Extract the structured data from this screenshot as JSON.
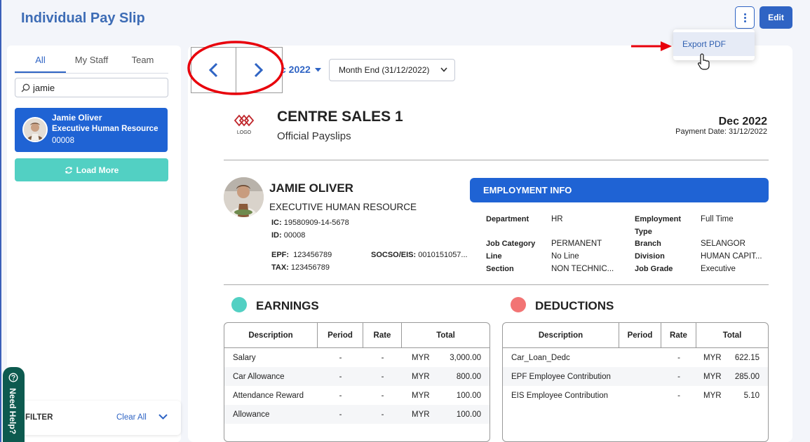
{
  "header": {
    "title": "Individual Pay Slip",
    "edit_label": "Edit",
    "export_pdf": "Export PDF"
  },
  "sidebar": {
    "tabs": [
      {
        "label": "All",
        "active": true
      },
      {
        "label": "My Staff"
      },
      {
        "label": "Team"
      }
    ],
    "search_value": "jamie",
    "staff_card": {
      "name": "Jamie Oliver",
      "role": "Executive Human Resource",
      "id": "00008"
    },
    "load_more": "Load More",
    "filter_label": "FILTER",
    "clear_all": "Clear All",
    "need_help": "Need Help?"
  },
  "toolbar": {
    "year": "c 2022",
    "month": "Month End (31/12/2022)"
  },
  "slip": {
    "logo_text": "LOGO",
    "company": "CENTRE SALES 1",
    "subtitle": "Official Payslips",
    "period": "Dec 2022",
    "payment_date": "Payment Date: 31/12/2022"
  },
  "employee": {
    "name": "JAMIE OLIVER",
    "title": "EXECUTIVE HUMAN RESOURCE",
    "ic_label": "IC:",
    "ic": "19580909-14-5678",
    "id_label": "ID:",
    "id": "00008",
    "epf_label": "EPF:",
    "epf": "123456789",
    "tax_label": "TAX:",
    "tax": "123456789",
    "socso_label": "SOCSO/EIS:",
    "socso": "0010151057..."
  },
  "employment_info": {
    "header": "EMPLOYMENT INFO",
    "left": [
      {
        "label": "Department",
        "value": "HR"
      },
      {
        "label": "Job Category",
        "value": "PERMANENT"
      },
      {
        "label": "Line",
        "value": "No Line"
      },
      {
        "label": "Section",
        "value": "NON TECHNIC..."
      }
    ],
    "right": [
      {
        "label": "Employment",
        "label2": "Type",
        "value": "Full Time"
      },
      {
        "label": "Branch",
        "value": "SELANGOR"
      },
      {
        "label": "Division",
        "value": "HUMAN CAPIT..."
      },
      {
        "label": "Job Grade",
        "value": "Executive"
      }
    ]
  },
  "earnings": {
    "title": "EARNINGS",
    "color": "#52d0c3",
    "columns": [
      "Description",
      "Period",
      "Rate",
      "Total"
    ],
    "rows": [
      {
        "desc": "Salary",
        "period": "-",
        "rate": "-",
        "cur": "MYR",
        "amt": "3,000.00"
      },
      {
        "desc": "Car Allowance",
        "period": "-",
        "rate": "-",
        "cur": "MYR",
        "amt": "800.00"
      },
      {
        "desc": "Attendance Reward",
        "period": "-",
        "rate": "-",
        "cur": "MYR",
        "amt": "100.00"
      },
      {
        "desc": "Allowance",
        "period": "-",
        "rate": "-",
        "cur": "MYR",
        "amt": "100.00"
      }
    ]
  },
  "deductions": {
    "title": "DEDUCTIONS",
    "color": "#f27474",
    "columns": [
      "Description",
      "Period",
      "Rate",
      "Total"
    ],
    "rows": [
      {
        "desc": "Car_Loan_Dedc",
        "period": "",
        "rate": "-",
        "cur": "MYR",
        "amt": "622.15"
      },
      {
        "desc": "EPF Employee Contribution",
        "period": "",
        "rate": "-",
        "cur": "MYR",
        "amt": "285.00"
      },
      {
        "desc": "EIS Employee Contribution",
        "period": "",
        "rate": "-",
        "cur": "MYR",
        "amt": "5.10"
      }
    ]
  },
  "colors": {
    "primary": "#1f63d4",
    "accent": "#52d0c3",
    "annotation": "#e8000b"
  }
}
